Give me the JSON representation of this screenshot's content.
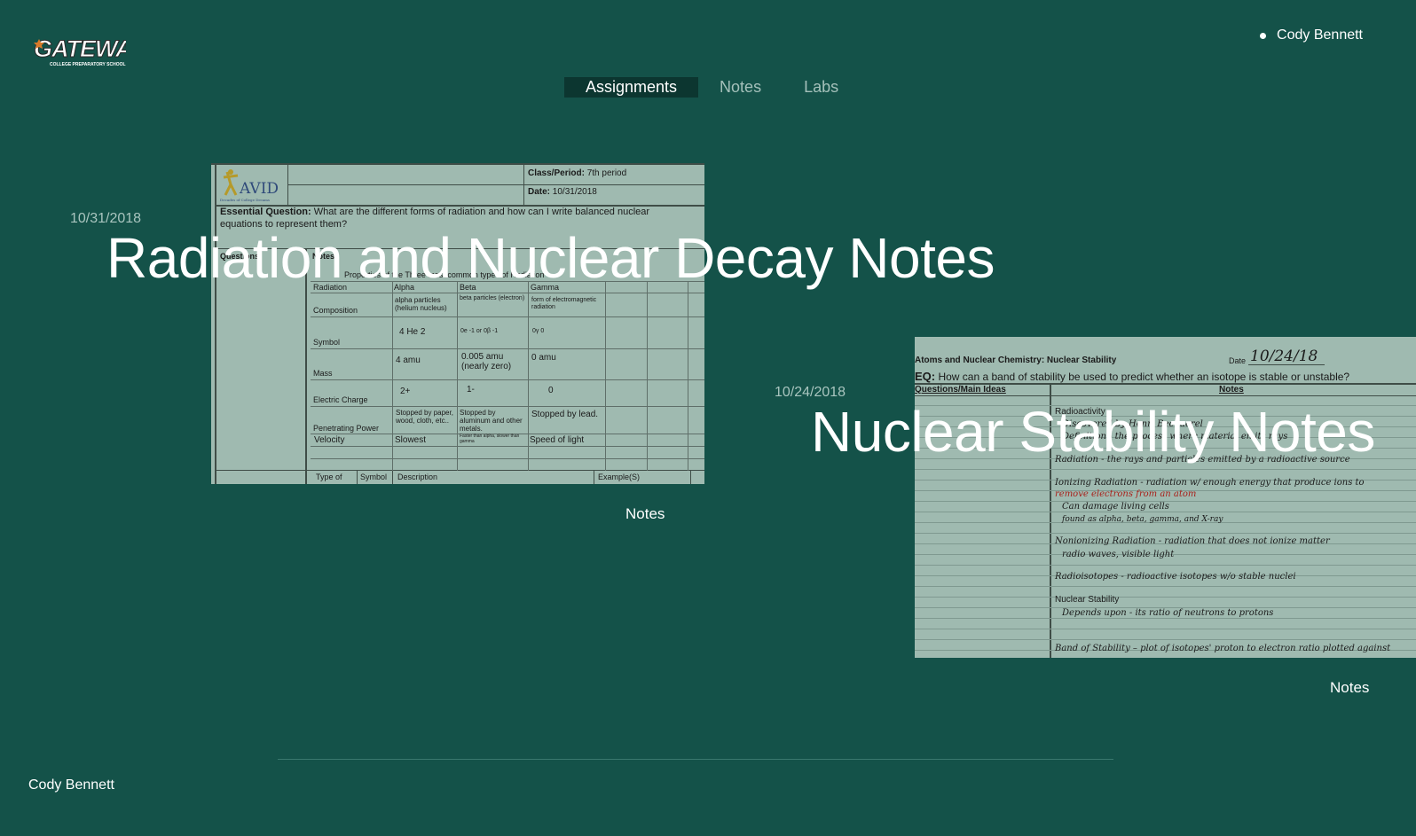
{
  "header": {
    "logo_text": "GATEWAY",
    "logo_subtext": "COLLEGE PREPARATORY SCHOOL",
    "user_name": "Cody Bennett"
  },
  "nav": {
    "items": [
      {
        "label": "Assignments",
        "active": true
      },
      {
        "label": "Notes",
        "active": false
      },
      {
        "label": "Labs",
        "active": false
      }
    ]
  },
  "posts": [
    {
      "date": "10/31/2018",
      "title": "Radiation and Nuclear Decay Notes",
      "tag": "Notes",
      "thumb": {
        "avid": "AVID",
        "avid_sub": "Decades of College Dreams",
        "class_period_label": "Class/Period:",
        "class_period_value": "7th period",
        "date_label": "Date:",
        "date_value": "10/31/2018",
        "eq_label": "Essential Question:",
        "eq_line1": "What are the different forms of radiation and how can I write balanced nuclear",
        "eq_line2": "equations to represent them?",
        "questions_label": "Questions:",
        "notes_label": "Notes:",
        "table_title": "Properties of the Three most common types of Radiation",
        "headers": [
          "Radiation",
          "Alpha",
          "Beta",
          "Gamma"
        ],
        "rows": [
          {
            "label": "Composition",
            "alpha": "alpha particles (helium nucleus)",
            "beta": "beta particles (electron)",
            "gamma": "form of electromagnetic radiation"
          },
          {
            "label": "Symbol",
            "alpha": "4 He 2",
            "beta": "0e -1  or  0β -1",
            "gamma": "0γ 0"
          },
          {
            "label": "Mass",
            "alpha": "4 amu",
            "beta": "0.005 amu (nearly zero)",
            "gamma": "0 amu"
          },
          {
            "label": "Electric Charge",
            "alpha": "2+",
            "beta": "1-",
            "gamma": "0"
          },
          {
            "label": "Penetrating Power",
            "alpha": "Stopped by paper, wood, cloth, etc..",
            "beta": "Stopped by aluminum and other metals.",
            "gamma": "Stopped by lead."
          },
          {
            "label": "Velocity",
            "alpha": "Slowest",
            "beta": "Faster than alpha, slower than gamma",
            "gamma": "Speed of light"
          }
        ],
        "bottom_headers": [
          "Type of",
          "Symbol",
          "Description",
          "Example(S)"
        ]
      }
    },
    {
      "date": "10/24/2018",
      "title": "Nuclear Stability Notes",
      "tag": "Notes",
      "thumb": {
        "heading": "Atoms and Nuclear Chemistry: Nuclear Stability",
        "date_label": "Date",
        "date_value": "10/24/18",
        "eq_label": "EQ:",
        "eq_text": "How can a band of stability be used to predict whether an isotope is stable or unstable?",
        "col_left": "Questions/Main Ideas",
        "col_right": "Notes",
        "lines": [
          "Radioactivity",
          "Discovered by Henri Becquerel",
          "Definition - the process where material emits rays",
          "Radiation - the rays and particles emitted by a radioactive source",
          "Ionizing Radiation - radiation w/ enough energy that produce ions to",
          "remove electrons from an atom",
          "Can damage living cells",
          "found as alpha, beta, gamma, and X-ray",
          "Nonionizing Radiation - radiation that does not ionize matter",
          "radio waves, visible light",
          "Radioisotopes - radioactive isotopes w/o stable nuclei",
          "Nuclear Stability",
          "Depends upon - its ratio of neutrons to protons",
          "Band of Stability – plot of isotopes' proton to electron ratio plotted against"
        ]
      }
    }
  ],
  "footer": {
    "name": "Cody Bennett"
  },
  "colors": {
    "background": "#145249",
    "nav_active_bg": "#0c3630",
    "muted_text": "#a9c5bf",
    "thumb_bg": "#9fbab0"
  }
}
